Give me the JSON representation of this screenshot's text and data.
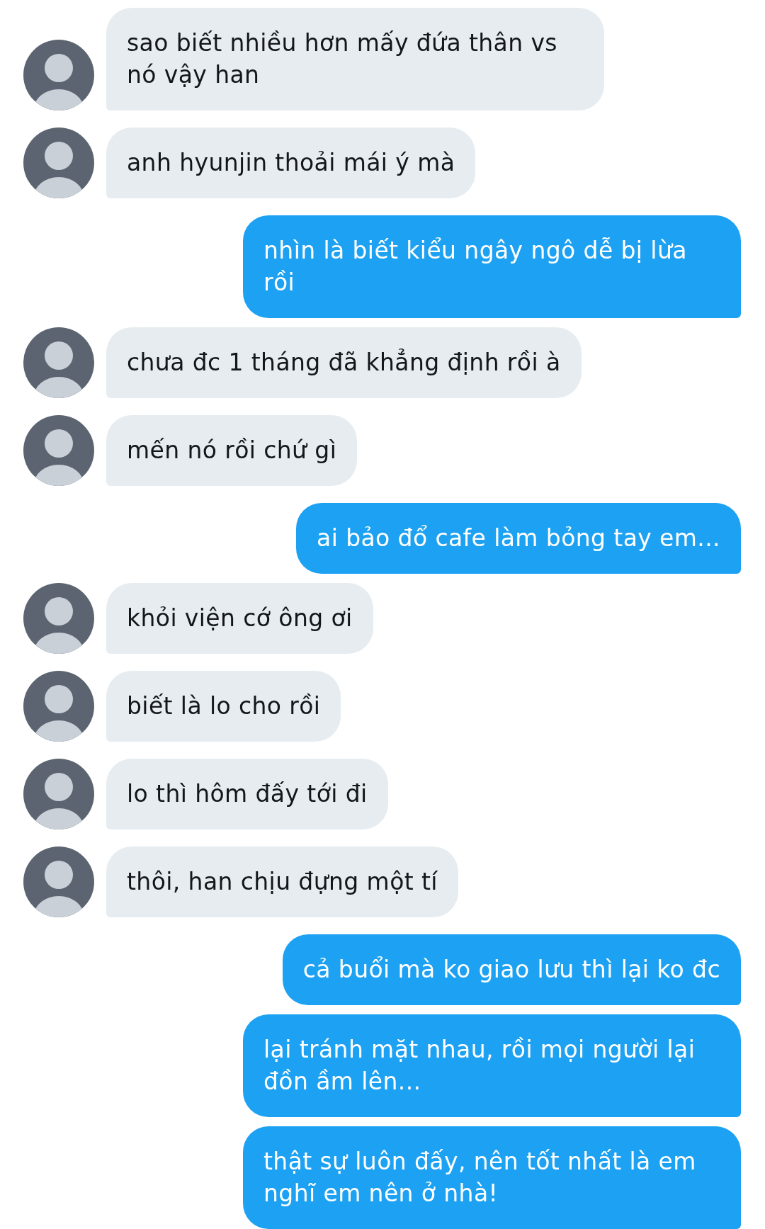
{
  "messages": [
    {
      "kind": "received",
      "text": "sao biết nhiều hơn mấy đứa thân vs nó vậy han"
    },
    {
      "kind": "received",
      "text": "anh hyunjin thoải mái ý mà"
    },
    {
      "kind": "sent",
      "text": "nhìn là biết kiểu ngây ngô dễ bị lừa rồi"
    },
    {
      "kind": "received",
      "text": "chưa đc 1 tháng đã khẳng định rồi à"
    },
    {
      "kind": "received",
      "text": "mến nó rồi chứ gì"
    },
    {
      "kind": "sent",
      "text": "ai bảo đổ cafe làm bỏng tay em..."
    },
    {
      "kind": "received",
      "text": "khỏi viện cớ ông ơi"
    },
    {
      "kind": "received",
      "text": "biết là lo cho rồi"
    },
    {
      "kind": "received",
      "text": "lo thì hôm đấy tới đi"
    },
    {
      "kind": "received",
      "text": "thôi, han chịu đựng một tí"
    },
    {
      "kind": "sent",
      "text": "cả buổi mà ko giao lưu thì lại ko đc"
    },
    {
      "kind": "sent",
      "text": "lại tránh mặt nhau, rồi mọi người lại đồn ầm lên..."
    },
    {
      "kind": "sent",
      "text": "thật sự luôn đấy, nên tốt nhất là em nghĩ em nên ở nhà!"
    }
  ]
}
